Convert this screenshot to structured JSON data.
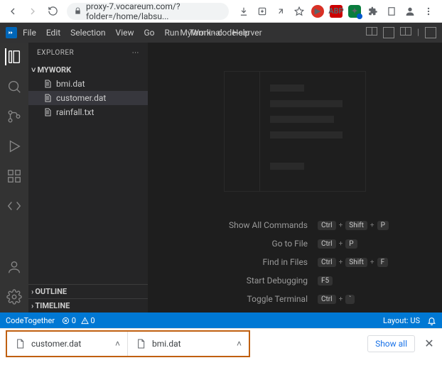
{
  "browser": {
    "url": "proxy-7.vocareum.com/?folder=/home/labsu..."
  },
  "titlebar": {
    "menu": [
      "File",
      "Edit",
      "Selection",
      "View",
      "Go",
      "Run",
      "Terminal",
      "Help"
    ],
    "title": "MyWork - code-server"
  },
  "sidebar": {
    "header": "EXPLORER",
    "project": "MYWORK",
    "files": [
      {
        "name": "bmi.dat",
        "selected": false
      },
      {
        "name": "customer.dat",
        "selected": true
      },
      {
        "name": "rainfall.txt",
        "selected": false
      }
    ],
    "outline": "OUTLINE",
    "timeline": "TIMELINE"
  },
  "commands": [
    {
      "label": "Show All Commands",
      "keys": [
        "Ctrl",
        "Shift",
        "P"
      ]
    },
    {
      "label": "Go to File",
      "keys": [
        "Ctrl",
        "P"
      ]
    },
    {
      "label": "Find in Files",
      "keys": [
        "Ctrl",
        "Shift",
        "F"
      ]
    },
    {
      "label": "Start Debugging",
      "keys": [
        "F5"
      ]
    },
    {
      "label": "Toggle Terminal",
      "keys": [
        "Ctrl",
        "`"
      ]
    }
  ],
  "statusbar": {
    "codetogether": "CodeTogether",
    "errors": "0",
    "warnings": "0",
    "layout": "Layout: US"
  },
  "downloads": {
    "items": [
      {
        "name": "customer.dat"
      },
      {
        "name": "bmi.dat"
      }
    ],
    "showall": "Show all"
  }
}
